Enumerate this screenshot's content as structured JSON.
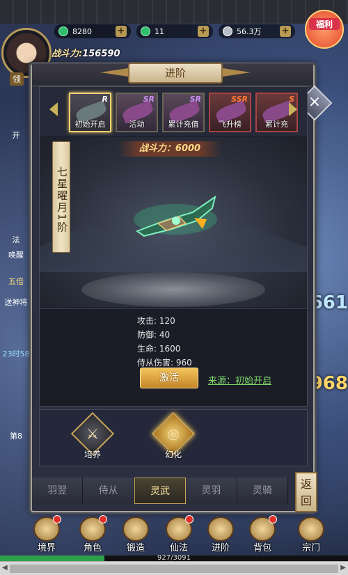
{
  "resources": {
    "jade": "8280",
    "gems": "11",
    "silver": "56.3万"
  },
  "welfare_label": "福利",
  "player": {
    "power_label": "战斗力",
    "power_value": "156590",
    "lingpin_label": "领"
  },
  "side_hud": {
    "left": [
      "开",
      "法",
      "唤醒",
      "五倍",
      "送神将",
      "23时58",
      "第8"
    ],
    "right": [
      "661",
      "968"
    ]
  },
  "panel": {
    "title": "进阶",
    "close_label": "×",
    "cards": [
      {
        "label": "初始开启",
        "rarity": "R",
        "active": true
      },
      {
        "label": "活动",
        "rarity": "SR",
        "active": false
      },
      {
        "label": "累计充值",
        "rarity": "SR",
        "active": false
      },
      {
        "label": "飞升榜",
        "rarity": "SSR",
        "active": false
      },
      {
        "label": "累计充",
        "rarity": "S",
        "active": false
      }
    ],
    "item_name": "七星曜月1阶",
    "item_power_label": "战斗力：",
    "item_power_value": "6000",
    "stats": [
      {
        "label": "攻击:",
        "value": "120"
      },
      {
        "label": "防御:",
        "value": "40"
      },
      {
        "label": "生命:",
        "value": "1600"
      },
      {
        "label": "侍从伤害:",
        "value": "960"
      }
    ],
    "activate_label": "激活",
    "source_text": "来源：初始开启",
    "skills": [
      {
        "label": "培养",
        "glyph": "⚔",
        "active": false
      },
      {
        "label": "幻化",
        "glyph": "◎",
        "active": true
      }
    ],
    "tabs": [
      "羽翌",
      "侍从",
      "灵武",
      "灵羽",
      "灵骑"
    ],
    "active_tab": "灵武",
    "back_label": "返回"
  },
  "bottom_nav": [
    {
      "label": "境界",
      "badge": true
    },
    {
      "label": "角色",
      "badge": true
    },
    {
      "label": "锻造",
      "badge": false
    },
    {
      "label": "仙法",
      "badge": true
    },
    {
      "label": "进阶",
      "badge": false
    },
    {
      "label": "背包",
      "badge": true
    },
    {
      "label": "宗门",
      "badge": false
    }
  ],
  "exp_text": "927/3091",
  "exp_fraction": 0.3,
  "colors": {
    "accent_gold": "#c9a45a",
    "source_green": "#7dd86a",
    "badge_red": "#e0302a"
  }
}
